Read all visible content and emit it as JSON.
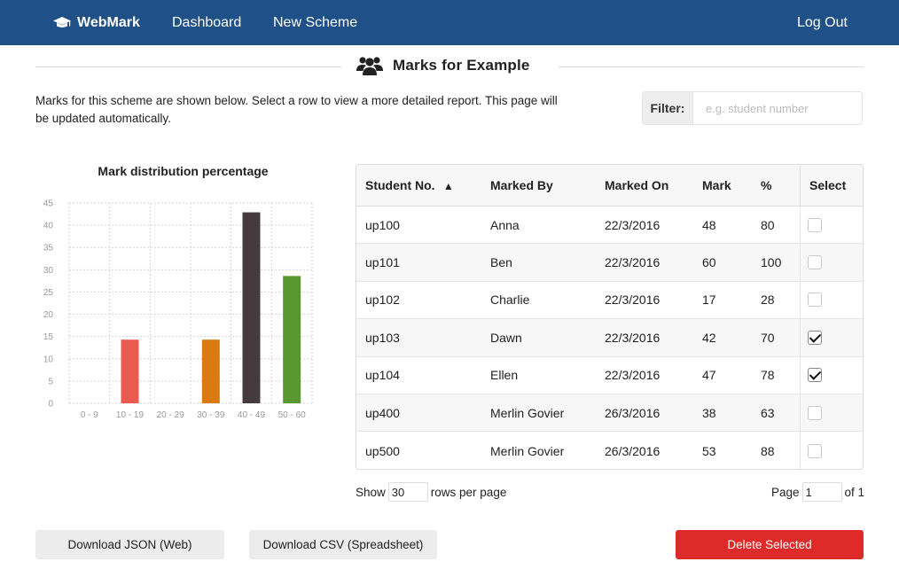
{
  "nav": {
    "brand": "WebMark",
    "links": [
      "Dashboard",
      "New Scheme"
    ],
    "logout": "Log Out"
  },
  "page": {
    "title": "Marks for Example",
    "intro": "Marks for this scheme are shown below. Select a row to view a more detailed report. This page will be updated automatically."
  },
  "filter": {
    "label": "Filter:",
    "placeholder": "e.g. student number",
    "value": ""
  },
  "chart_data": {
    "type": "bar",
    "title": "Mark distribution percentage",
    "categories": [
      "0 - 9",
      "10 - 19",
      "20 - 29",
      "30 - 39",
      "40 - 49",
      "50 - 60"
    ],
    "values": [
      0,
      14.3,
      0,
      14.3,
      42.9,
      28.6
    ],
    "colors": [
      "#eb5a50",
      "#eb5a50",
      "#d97b12",
      "#d97b12",
      "#453b3e",
      "#5a9632"
    ],
    "ylim": [
      0,
      45
    ],
    "yticks": [
      0,
      5,
      10,
      15,
      20,
      25,
      30,
      35,
      40,
      45
    ],
    "grid": true
  },
  "table": {
    "columns": [
      "Student No.",
      "Marked By",
      "Marked On",
      "Mark",
      "%",
      "Select"
    ],
    "sorted_column": "Student No.",
    "sort_direction": "ascending",
    "rows": [
      {
        "student": "up100",
        "marker": "Anna",
        "date": "22/3/2016",
        "mark": "48",
        "pct": "80",
        "selected": false
      },
      {
        "student": "up101",
        "marker": "Ben",
        "date": "22/3/2016",
        "mark": "60",
        "pct": "100",
        "selected": false
      },
      {
        "student": "up102",
        "marker": "Charlie",
        "date": "22/3/2016",
        "mark": "17",
        "pct": "28",
        "selected": false
      },
      {
        "student": "up103",
        "marker": "Dawn",
        "date": "22/3/2016",
        "mark": "42",
        "pct": "70",
        "selected": true
      },
      {
        "student": "up104",
        "marker": "Ellen",
        "date": "22/3/2016",
        "mark": "47",
        "pct": "78",
        "selected": true
      },
      {
        "student": "up400",
        "marker": "Merlin Govier",
        "date": "26/3/2016",
        "mark": "38",
        "pct": "63",
        "selected": false
      },
      {
        "student": "up500",
        "marker": "Merlin Govier",
        "date": "26/3/2016",
        "mark": "53",
        "pct": "88",
        "selected": false
      }
    ]
  },
  "pagination": {
    "show_label": "Show",
    "rows_value": "30",
    "rows_suffix": "rows per page",
    "page_label": "Page",
    "page_value": "1",
    "page_total": "of 1"
  },
  "buttons": {
    "download_json": "Download JSON (Web)",
    "download_csv": "Download CSV (Spreadsheet)",
    "delete_selected": "Delete Selected"
  },
  "colors": {
    "navbar": "#1f5188",
    "delete": "#df2a2a",
    "button_grey": "#ececec"
  },
  "icons": {
    "brand": "graduation-cap-icon",
    "title": "users-group-icon"
  }
}
